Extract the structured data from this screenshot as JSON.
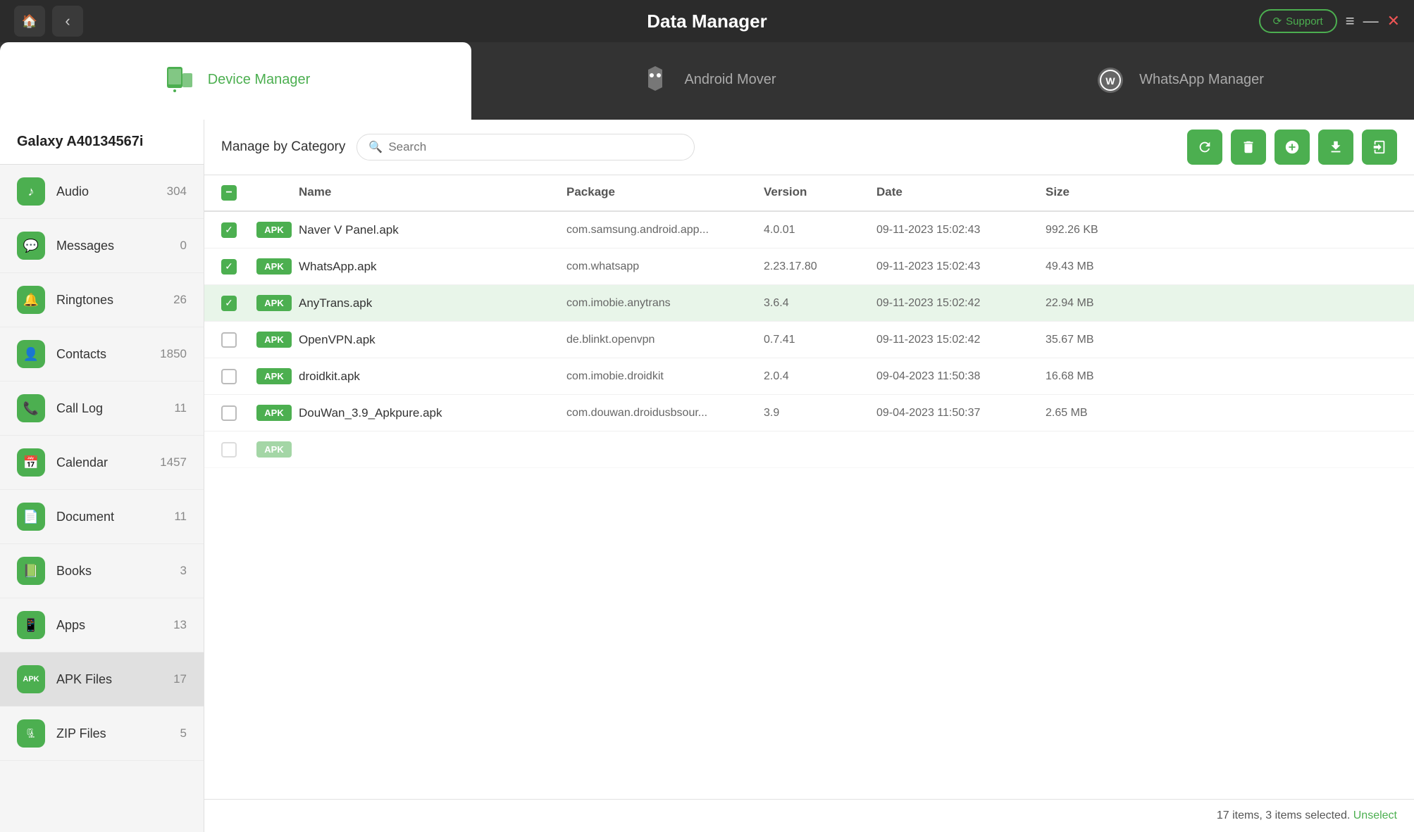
{
  "app": {
    "title": "Data Manager"
  },
  "title_bar": {
    "home_label": "🏠",
    "back_label": "‹",
    "support_label": "Support",
    "menu_label": "≡",
    "minimize_label": "—",
    "close_label": "✕"
  },
  "tabs": [
    {
      "id": "device-manager",
      "label": "Device Manager",
      "active": true
    },
    {
      "id": "android-mover",
      "label": "Android Mover",
      "active": false
    },
    {
      "id": "whatsapp-manager",
      "label": "WhatsApp Manager",
      "active": false
    }
  ],
  "sidebar": {
    "device_name": "Galaxy A40134567i",
    "items": [
      {
        "id": "audio",
        "label": "Audio",
        "count": "304",
        "icon": "♪"
      },
      {
        "id": "messages",
        "label": "Messages",
        "count": "0",
        "icon": "💬"
      },
      {
        "id": "ringtones",
        "label": "Ringtones",
        "count": "26",
        "icon": "🔔"
      },
      {
        "id": "contacts",
        "label": "Contacts",
        "count": "1850",
        "icon": "👤"
      },
      {
        "id": "call-log",
        "label": "Call Log",
        "count": "11",
        "icon": "📞"
      },
      {
        "id": "calendar",
        "label": "Calendar",
        "count": "1457",
        "icon": "📅"
      },
      {
        "id": "document",
        "label": "Document",
        "count": "11",
        "icon": "📄"
      },
      {
        "id": "books",
        "label": "Books",
        "count": "3",
        "icon": "📗"
      },
      {
        "id": "apps",
        "label": "Apps",
        "count": "13",
        "icon": "📱"
      },
      {
        "id": "apk-files",
        "label": "APK Files",
        "count": "17",
        "icon": "APK",
        "active": true
      },
      {
        "id": "zip-files",
        "label": "ZIP Files",
        "count": "5",
        "icon": "🗜"
      }
    ]
  },
  "toolbar": {
    "manage_label": "Manage by Category",
    "search_placeholder": "Search",
    "actions": [
      {
        "id": "refresh",
        "icon": "↻",
        "label": "Refresh"
      },
      {
        "id": "delete",
        "icon": "🗑",
        "label": "Delete"
      },
      {
        "id": "add",
        "icon": "⊕",
        "label": "Add"
      },
      {
        "id": "export",
        "icon": "⬇",
        "label": "Export"
      },
      {
        "id": "signin",
        "icon": "→",
        "label": "Sign In"
      }
    ]
  },
  "table": {
    "columns": [
      {
        "id": "checkbox",
        "label": ""
      },
      {
        "id": "icon",
        "label": ""
      },
      {
        "id": "name",
        "label": "Name"
      },
      {
        "id": "package",
        "label": "Package"
      },
      {
        "id": "version",
        "label": "Version"
      },
      {
        "id": "date",
        "label": "Date"
      },
      {
        "id": "size",
        "label": "Size"
      }
    ],
    "rows": [
      {
        "id": "row1",
        "checked": true,
        "name": "Naver V Panel.apk",
        "package": "com.samsung.android.app...",
        "version": "4.0.01",
        "date": "09-11-2023 15:02:43",
        "size": "992.26 KB",
        "selected": false
      },
      {
        "id": "row2",
        "checked": true,
        "name": "WhatsApp.apk",
        "package": "com.whatsapp",
        "version": "2.23.17.80",
        "date": "09-11-2023 15:02:43",
        "size": "49.43 MB",
        "selected": false
      },
      {
        "id": "row3",
        "checked": true,
        "name": "AnyTrans.apk",
        "package": "com.imobie.anytrans",
        "version": "3.6.4",
        "date": "09-11-2023 15:02:42",
        "size": "22.94 MB",
        "selected": true
      },
      {
        "id": "row4",
        "checked": false,
        "name": "OpenVPN.apk",
        "package": "de.blinkt.openvpn",
        "version": "0.7.41",
        "date": "09-11-2023 15:02:42",
        "size": "35.67 MB",
        "selected": false
      },
      {
        "id": "row5",
        "checked": false,
        "name": "droidkit.apk",
        "package": "com.imobie.droidkit",
        "version": "2.0.4",
        "date": "09-04-2023 11:50:38",
        "size": "16.68 MB",
        "selected": false
      },
      {
        "id": "row6",
        "checked": false,
        "name": "DouWan_3.9_Apkpure.apk",
        "package": "com.douwan.droidusbsour...",
        "version": "3.9",
        "date": "09-04-2023 11:50:37",
        "size": "2.65 MB",
        "selected": false
      },
      {
        "id": "row7",
        "checked": false,
        "name": "",
        "package": "",
        "version": "",
        "date": "",
        "size": "",
        "selected": false,
        "partial": true
      }
    ]
  },
  "status": {
    "text": "17 items, 3 items selected.",
    "unselect_label": "Unselect"
  },
  "colors": {
    "green": "#4caf50",
    "selected_bg": "#e8f5e9",
    "dark_bg": "#2b2b2b"
  }
}
